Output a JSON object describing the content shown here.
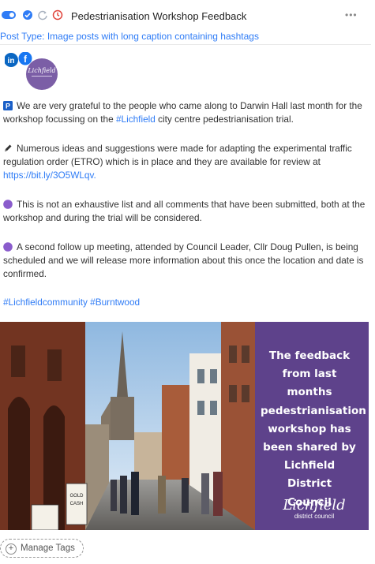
{
  "header": {
    "title": "Pedestrianisation Workshop Feedback",
    "more_label": "•••"
  },
  "post_type": "Post Type: Image posts with long caption containing hashtags",
  "avatar": {
    "networks": [
      "in",
      "f"
    ],
    "logo_text": "Lichfield"
  },
  "post": {
    "p1_pre": "We are very grateful to the people who came along to Darwin Hall last month for the workshop focussing on the ",
    "p1_link": "#Lichfield",
    "p1_post": " city centre pedestrianisation trial.",
    "p2_pre": "Numerous ideas and suggestions were made for adapting the experimental traffic regulation order (ETRO) which is in place and they are available for review at ",
    "p2_link": "https://bit.ly/3O5WLqv.",
    "p3": "This is not an exhaustive list and all comments that have been submitted, both at the workshop and during the trial will be considered.",
    "p4": "A second follow up meeting, attended by Council Leader, Cllr Doug Pullen, is being scheduled and we will release more information about this once the location and date is confirmed.",
    "hashtags": "#Lichfieldcommunity #Burntwood"
  },
  "image": {
    "overlay_lines": [
      "The feedback",
      "from last months",
      "pedestrianisation",
      "workshop has",
      "been shared by",
      "Lichfield District",
      "Council"
    ],
    "logo_main": "Lichfield",
    "logo_sub": "district council",
    "sign_text": "GOLD CASH"
  },
  "manage_tags_label": "Manage Tags"
}
